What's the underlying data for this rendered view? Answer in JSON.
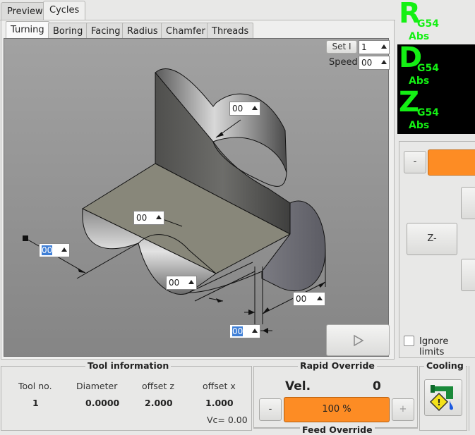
{
  "tabs": [
    "Preview",
    "Cycles"
  ],
  "subtabs": [
    "Turning",
    "Boring",
    "Facing",
    "Radius",
    "Chamfer",
    "Threads"
  ],
  "set_label": "Set I",
  "set_value": "1",
  "speed_label": "Speed",
  "speed_value": "00",
  "drawing_fields": {
    "radius_top": "00",
    "face_width": "00",
    "left_len": "00",
    "bottom_len": "00",
    "right_len": "00",
    "depth": "00"
  },
  "run_icon": "play-icon",
  "dro": [
    {
      "axis": "R",
      "coord": "G54",
      "mode": "Abs"
    },
    {
      "axis": "D",
      "coord": "G54",
      "mode": "Abs"
    },
    {
      "axis": "Z",
      "coord": "G54",
      "mode": "Abs"
    }
  ],
  "jog": {
    "minus_label": "-",
    "z_minus_label": "Z-",
    "ignore_limits_label": "Ignore limits"
  },
  "tool_info": {
    "title": "Tool information",
    "headers": [
      "Tool no.",
      "Diameter",
      "offset z",
      "offset x"
    ],
    "values": [
      "1",
      "0.0000",
      "2.000",
      "1.000"
    ],
    "vc": "Vc= 0.00"
  },
  "rapid": {
    "title": "Rapid Override",
    "vel_label": "Vel.",
    "vel_value": "0",
    "minus": "-",
    "percent": "100 %",
    "plus": "+"
  },
  "feed": {
    "title": "Feed Override"
  },
  "cooling": {
    "title": "Cooling",
    "icon": "coolant-tap-icon"
  },
  "colors": {
    "accent": "#fd8c24",
    "dro_bg": "#000000",
    "dro_text": "#14f014"
  }
}
